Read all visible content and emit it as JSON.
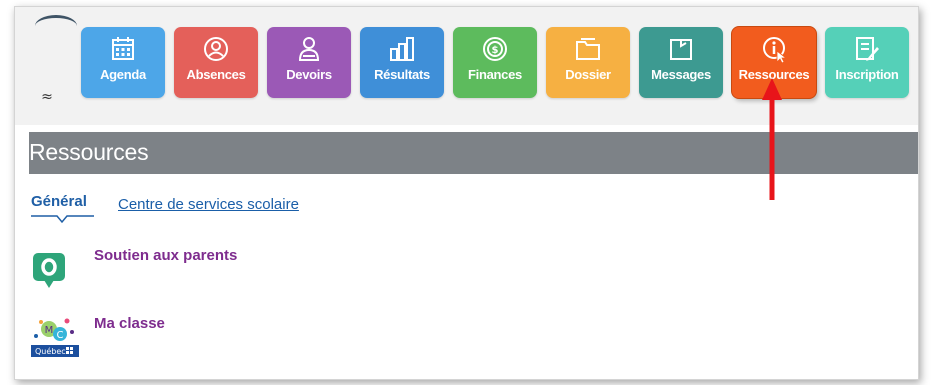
{
  "toolbar": {
    "tiles": [
      {
        "label": "Agenda",
        "color": "#4da6e8",
        "icon": "calendar-icon"
      },
      {
        "label": "Absences",
        "color": "#e4605a",
        "icon": "absence-icon"
      },
      {
        "label": "Devoirs",
        "color": "#9b59b6",
        "icon": "student-icon"
      },
      {
        "label": "Résultats",
        "color": "#3f8fd8",
        "icon": "bar-chart-icon"
      },
      {
        "label": "Finances",
        "color": "#5dbb5d",
        "icon": "money-icon"
      },
      {
        "label": "Dossier",
        "color": "#f6b042",
        "icon": "folder-icon"
      },
      {
        "label": "Messages",
        "color": "#3d9a91",
        "icon": "note-icon"
      },
      {
        "label": "Ressources",
        "color": "#f25c1e",
        "icon": "info-icon"
      },
      {
        "label": "Inscription",
        "color": "#55d0b8",
        "icon": "form-edit-icon"
      }
    ],
    "collapse_glyph": "≈"
  },
  "page": {
    "title": "Ressources"
  },
  "tabs": {
    "general": "Général",
    "centre": "Centre de services scolaire"
  },
  "resources": [
    {
      "label": "Soutien aux parents",
      "icon": "chat-bubble-icon",
      "color": "#2ea57a"
    },
    {
      "label": "Ma classe",
      "icon": "ma-classe-logo",
      "badge": "Québec"
    }
  ],
  "annotation": {
    "color": "#e8141a"
  }
}
